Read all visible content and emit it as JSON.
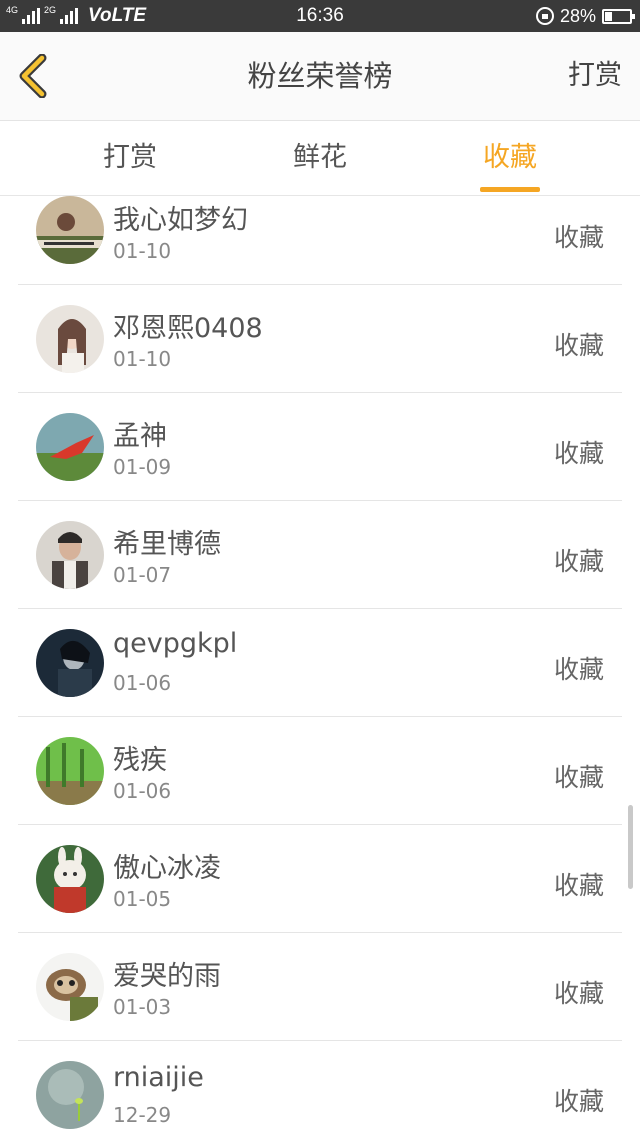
{
  "status_bar": {
    "net1": "4G",
    "net2": "2G",
    "volte": "VoLTE",
    "time": "16:36",
    "battery": "28%"
  },
  "header": {
    "back_icon": "chevron-left-icon",
    "title": "粉丝荣誉榜",
    "action": "打赏"
  },
  "tabs": [
    {
      "label": "打赏",
      "active": false
    },
    {
      "label": "鲜花",
      "active": false
    },
    {
      "label": "收藏",
      "active": true
    }
  ],
  "accent_color": "#f5a623",
  "list": [
    {
      "name": "我心如梦幻",
      "date": "01-10",
      "action": "收藏"
    },
    {
      "name": "邓恩熙0408",
      "date": "01-10",
      "action": "收藏"
    },
    {
      "name": "孟神",
      "date": "01-09",
      "action": "收藏"
    },
    {
      "name": "希里博德",
      "date": "01-07",
      "action": "收藏"
    },
    {
      "name": "qevpgkpl",
      "date": "01-06",
      "action": "收藏"
    },
    {
      "name": "残疾",
      "date": "01-06",
      "action": "收藏"
    },
    {
      "name": "傲心冰凌",
      "date": "01-05",
      "action": "收藏"
    },
    {
      "name": "爱哭的雨",
      "date": "01-03",
      "action": "收藏"
    },
    {
      "name": "rniaijie",
      "date": "12-29",
      "action": "收藏"
    }
  ]
}
